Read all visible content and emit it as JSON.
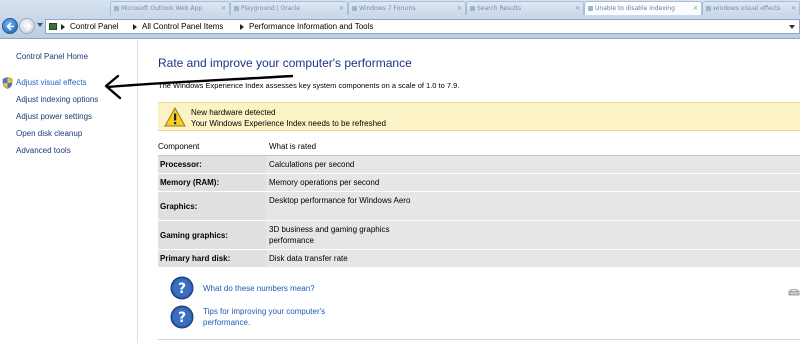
{
  "browser_tabs": [
    "Microsoft Outlook Web App",
    "Playground | Oracle",
    "Windows 7 Forums",
    "Search Results",
    "Unable to disable indexing",
    "windows visual effects"
  ],
  "address_bar": {
    "breadcrumbs": [
      "Control Panel",
      "All Control Panel Items",
      "Performance Information and Tools"
    ]
  },
  "sidebar": {
    "items": [
      {
        "label": "Control Panel Home"
      },
      {
        "label": "Adjust visual effects",
        "icon": "shield-icon"
      },
      {
        "label": "Adjust indexing options"
      },
      {
        "label": "Adjust power settings"
      },
      {
        "label": "Open disk cleanup"
      },
      {
        "label": "Advanced tools"
      }
    ]
  },
  "main": {
    "title": "Rate and improve your computer's performance",
    "description": "The Windows Experience Index assesses key system components on a scale of 1.0 to 7.9.",
    "notice": {
      "icon": "warning-icon",
      "line1": "New hardware detected",
      "line2": "Your Windows Experience Index needs to be refreshed"
    },
    "table": {
      "headers": {
        "component": "Component",
        "rated": "What is rated"
      },
      "rows": [
        {
          "component": "Processor:",
          "rated": "Calculations per second"
        },
        {
          "component": "Memory (RAM):",
          "rated": "Memory operations per second"
        },
        {
          "component": "Graphics:",
          "rated": "Desktop performance for Windows Aero"
        },
        {
          "component": "Gaming graphics:",
          "rated": "3D business and gaming graphics performance"
        },
        {
          "component": "Primary hard disk:",
          "rated": "Disk data transfer rate"
        }
      ]
    },
    "help_links": [
      {
        "icon": "help-icon",
        "label": "What do these numbers mean?"
      },
      {
        "icon": "help-icon",
        "label": "Tips for improving your computer's performance."
      }
    ]
  },
  "colors": {
    "title_blue": "#1e3287",
    "link_blue": "#1e3b76",
    "notice_yellow": "#fbf3c6",
    "table_gray": "#e6e6e6"
  }
}
